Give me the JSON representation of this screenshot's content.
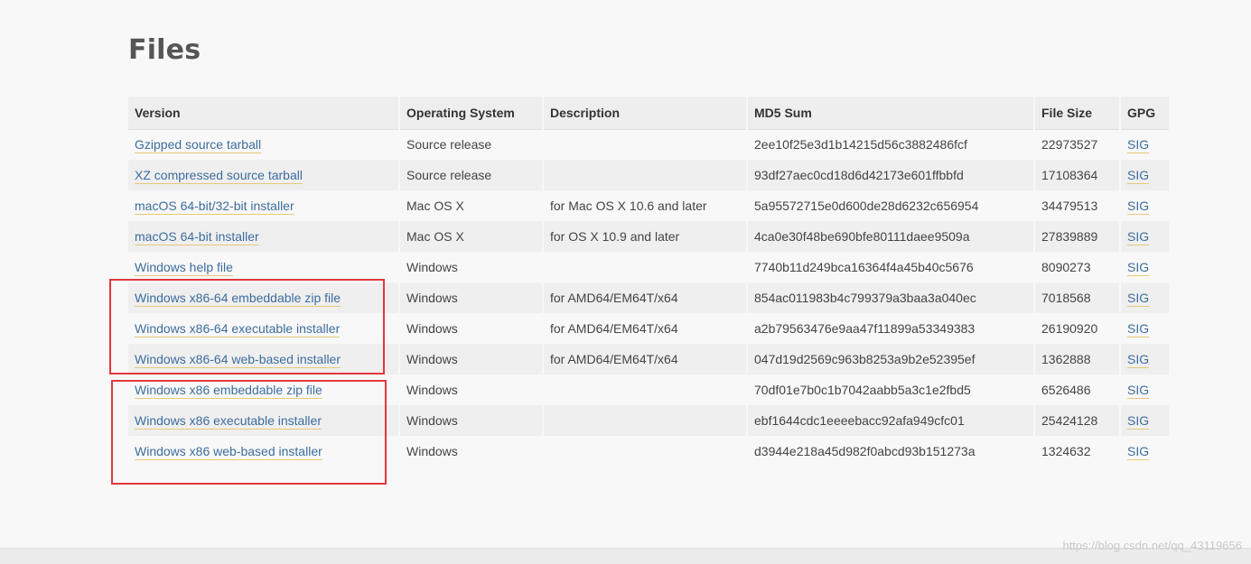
{
  "page": {
    "title": "Files"
  },
  "table": {
    "headers": [
      "Version",
      "Operating System",
      "Description",
      "MD5 Sum",
      "File Size",
      "GPG"
    ],
    "rows": [
      {
        "version": "Gzipped source tarball",
        "os": "Source release",
        "description": "",
        "md5": "2ee10f25e3d1b14215d56c3882486fcf",
        "size": "22973527",
        "gpg": "SIG"
      },
      {
        "version": "XZ compressed source tarball",
        "os": "Source release",
        "description": "",
        "md5": "93df27aec0cd18d6d42173e601ffbbfd",
        "size": "17108364",
        "gpg": "SIG"
      },
      {
        "version": "macOS 64-bit/32-bit installer",
        "os": "Mac OS X",
        "description": "for Mac OS X 10.6 and later",
        "md5": "5a95572715e0d600de28d6232c656954",
        "size": "34479513",
        "gpg": "SIG"
      },
      {
        "version": "macOS 64-bit installer",
        "os": "Mac OS X",
        "description": "for OS X 10.9 and later",
        "md5": "4ca0e30f48be690bfe80111daee9509a",
        "size": "27839889",
        "gpg": "SIG"
      },
      {
        "version": "Windows help file",
        "os": "Windows",
        "description": "",
        "md5": "7740b11d249bca16364f4a45b40c5676",
        "size": "8090273",
        "gpg": "SIG"
      },
      {
        "version": "Windows x86-64 embeddable zip file",
        "os": "Windows",
        "description": "for AMD64/EM64T/x64",
        "md5": "854ac011983b4c799379a3baa3a040ec",
        "size": "7018568",
        "gpg": "SIG"
      },
      {
        "version": "Windows x86-64 executable installer",
        "os": "Windows",
        "description": "for AMD64/EM64T/x64",
        "md5": "a2b79563476e9aa47f11899a53349383",
        "size": "26190920",
        "gpg": "SIG"
      },
      {
        "version": "Windows x86-64 web-based installer",
        "os": "Windows",
        "description": "for AMD64/EM64T/x64",
        "md5": "047d19d2569c963b8253a9b2e52395ef",
        "size": "1362888",
        "gpg": "SIG"
      },
      {
        "version": "Windows x86 embeddable zip file",
        "os": "Windows",
        "description": "",
        "md5": "70df01e7b0c1b7042aabb5a3c1e2fbd5",
        "size": "6526486",
        "gpg": "SIG"
      },
      {
        "version": "Windows x86 executable installer",
        "os": "Windows",
        "description": "",
        "md5": "ebf1644cdc1eeeebacc92afa949cfc01",
        "size": "25424128",
        "gpg": "SIG"
      },
      {
        "version": "Windows x86 web-based installer",
        "os": "Windows",
        "description": "",
        "md5": "d3944e218a45d982f0abcd93b151273a",
        "size": "1324632",
        "gpg": "SIG"
      }
    ]
  },
  "colors": {
    "link": "#3d6d9e",
    "link_underline": "#e8c877",
    "highlight_box": "#e0393c"
  },
  "watermark": "https://blog.csdn.net/qq_43119656"
}
